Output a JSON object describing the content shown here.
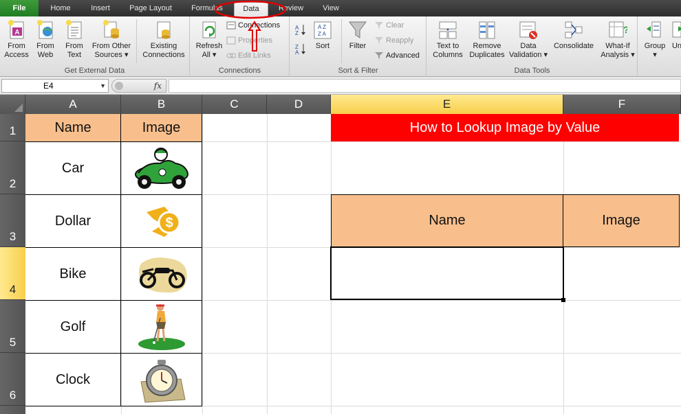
{
  "tabs": [
    "File",
    "Home",
    "Insert",
    "Page Layout",
    "Formulas",
    "Data",
    "Review",
    "View"
  ],
  "active_tab": "Data",
  "ribbon": {
    "get_external_data": {
      "label": "Get External Data",
      "buttons": [
        {
          "line1": "From",
          "line2": "Access",
          "icon": "access-icon"
        },
        {
          "line1": "From",
          "line2": "Web",
          "icon": "web-icon"
        },
        {
          "line1": "From",
          "line2": "Text",
          "icon": "text-file-icon"
        },
        {
          "line1": "From Other",
          "line2": "Sources ▾",
          "icon": "other-sources-icon"
        }
      ]
    },
    "existing": {
      "line1": "Existing",
      "line2": "Connections",
      "icon": "existing-connections-icon"
    },
    "connections": {
      "label": "Connections",
      "refresh": {
        "line1": "Refresh",
        "line2": "All ▾",
        "icon": "refresh-icon"
      },
      "connections": "Connections",
      "properties": "Properties",
      "edit_links": "Edit Links"
    },
    "sort_filter": {
      "label": "Sort & Filter",
      "sort": "Sort",
      "filter": "Filter",
      "clear": "Clear",
      "reapply": "Reapply",
      "advanced": "Advanced"
    },
    "data_tools": {
      "label": "Data Tools",
      "text_to_columns": {
        "line1": "Text to",
        "line2": "Columns"
      },
      "remove_duplicates": {
        "line1": "Remove",
        "line2": "Duplicates"
      },
      "data_validation": {
        "line1": "Data",
        "line2": "Validation ▾"
      },
      "consolidate": "Consolidate",
      "what_if": {
        "line1": "What-If",
        "line2": "Analysis ▾"
      }
    },
    "outline": {
      "group": "Group",
      "ungroup": "Un"
    }
  },
  "formula_bar": {
    "name_box": "E4",
    "fx": "fx",
    "formula": ""
  },
  "sheet": {
    "columns": [
      "A",
      "B",
      "C",
      "D",
      "E",
      "F"
    ],
    "selected_column": "E",
    "rows": [
      "1",
      "2",
      "3",
      "4",
      "5",
      "6"
    ],
    "selected_row": "4",
    "header_name": "Name",
    "header_image": "Image",
    "items": [
      {
        "name": "Car",
        "image": "car-icon"
      },
      {
        "name": "Dollar",
        "image": "dollar-icon"
      },
      {
        "name": "Bike",
        "image": "motorbike-icon"
      },
      {
        "name": "Golf",
        "image": "golfer-icon"
      },
      {
        "name": "Clock",
        "image": "clock-icon"
      }
    ],
    "title": "How to Lookup Image by Value",
    "lookup_name_header": "Name",
    "lookup_image_header": "Image",
    "lookup_name_value": "",
    "lookup_image_value": ""
  },
  "colors": {
    "title_bg": "#ff0000",
    "header_bg": "#f8bf8c",
    "annotation": "#e00000"
  }
}
